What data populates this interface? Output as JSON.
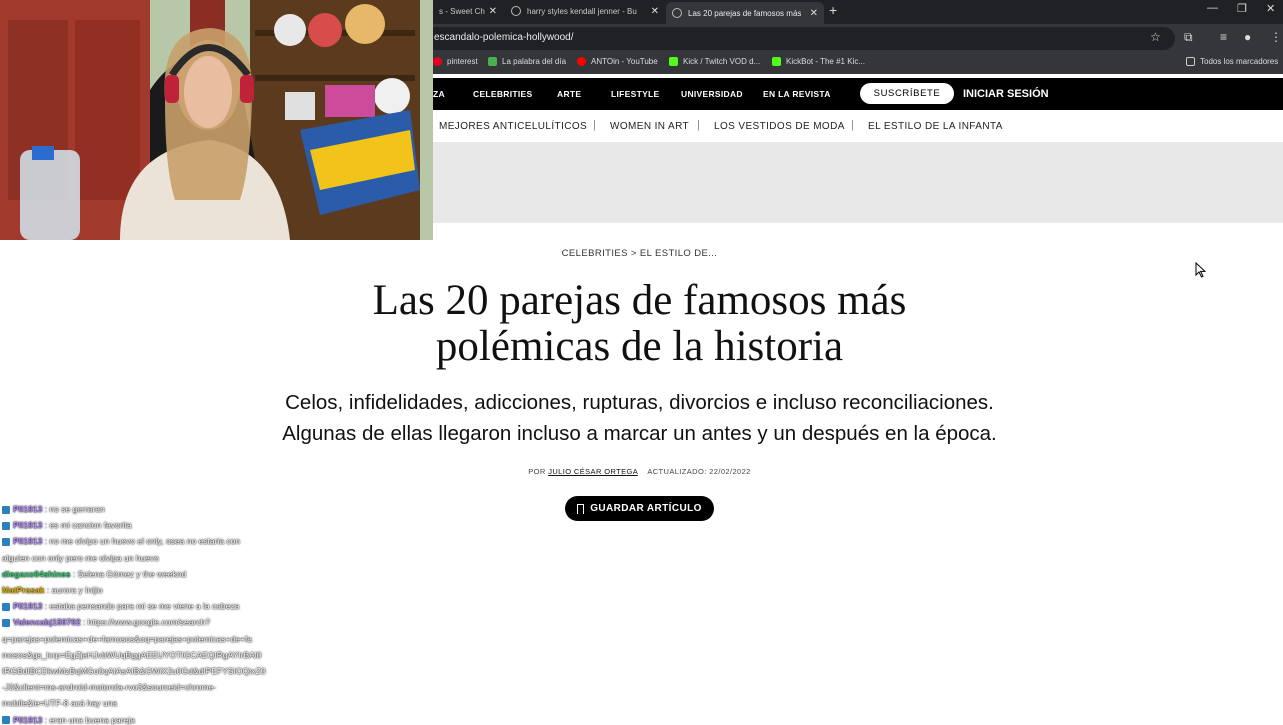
{
  "browser": {
    "tabs": [
      {
        "label": "s - Sweet Ch",
        "active": false
      },
      {
        "label": "harry styles kendall jenner - Bu",
        "active": false
      },
      {
        "label": "Las 20 parejas de famosos más",
        "active": true
      }
    ],
    "url": "escandalo-polemica-hollywood/",
    "bookmarks": [
      {
        "label": "pinterest",
        "color": "#e60023"
      },
      {
        "label": "La palabra del día",
        "color": "#4caf50"
      },
      {
        "label": "ANTOin - YouTube",
        "color": "#ff0000"
      },
      {
        "label": "Kick / Twitch VOD d...",
        "color": "#53fc18"
      },
      {
        "label": "KickBot - The #1 Kic...",
        "color": "#53fc18"
      }
    ],
    "all_bookmarks": "Todos los marcadores"
  },
  "site": {
    "nav": [
      "ZA",
      "CELEBRITIES",
      "ARTE",
      "LIFESTYLE",
      "UNIVERSIDAD",
      "EN LA REVISTA"
    ],
    "subscribe": "SUSCRÍBETE",
    "login": "INICIAR SESIÓN",
    "subnav": [
      "MEJORES ANTICELULÍTICOS",
      "WOMEN IN ART",
      "LOS VESTIDOS DE MODA",
      "EL ESTILO DE LA INFANTA"
    ]
  },
  "article": {
    "breadcrumb": "CELEBRITIES > EL ESTILO DE...",
    "headline_line1": "Las 20 parejas de famosos más",
    "headline_line2": "polémicas de la historia",
    "dek_line1": "Celos, infidelidades, adicciones, rupturas, divorcios e incluso reconciliaciones.",
    "dek_line2": "Algunas de ellas llegaron incluso a marcar un antes y un después en la época.",
    "byline_prefix": "POR",
    "author": "JULIO CÉSAR ORTEGA",
    "updated": "ACTUALIZADO: 22/02/2022",
    "save_button": "GUARDAR ARTÍCULO"
  },
  "chat": [
    {
      "user": "Pll1913",
      "color": "#b48cff",
      "badge": true,
      "text": ": no se gerraran"
    },
    {
      "user": "Pll1913",
      "color": "#b48cff",
      "badge": true,
      "text": ": es mi cancion favorita"
    },
    {
      "user": "Pll1913",
      "color": "#b48cff",
      "badge": true,
      "text": ": no me olvipo un huevo el only, osea no estaria con"
    },
    {
      "user": "",
      "color": "#ffffff",
      "badge": false,
      "text": "alguien con only pero me olvipa un huevo"
    },
    {
      "user": "diegaxo04shines",
      "color": "#2ecc71",
      "badge": false,
      "text": ": Selena Gómez y the weeknd"
    },
    {
      "user": "MatPrasak",
      "color": "#e6b800",
      "badge": false,
      "text": ": aurora y Inijio"
    },
    {
      "user": "Pll1913",
      "color": "#b48cff",
      "badge": true,
      "text": ": estaba pensando para mi se me viene a la cabeza"
    },
    {
      "user": "Valencabj150702",
      "color": "#b48cff",
      "badge": true,
      "text": ": https://www.google.com/search?"
    },
    {
      "user": "",
      "color": "#ffffff",
      "badge": false,
      "text": "q=parejas+polemicas+de+famosos&oq=parejas+polemicas+de+fa"
    },
    {
      "user": "",
      "color": "#ffffff",
      "badge": false,
      "text": "mosos&gs_lcrp=EgZjaHJvbWUqBggAEEUYOTIGCAEQIRgAYIrBAl0"
    },
    {
      "user": "",
      "color": "#ffffff",
      "badge": false,
      "text": "IRGBdIBCDkwMzBqMGo0qAIAsAIB&GWiX2u0Gd&dIPEFYSIOQtxZ0"
    },
    {
      "user": "",
      "color": "#ffffff",
      "badge": false,
      "text": "-J0&client=ms-android-motorola-rvo3&sourceid=chrome-"
    },
    {
      "user": "",
      "color": "#ffffff",
      "badge": false,
      "text": "mobile&ie=UTF-8 acá hay una"
    },
    {
      "user": "Pll1913",
      "color": "#b48cff",
      "badge": true,
      "text": ": eran una buena pareja"
    }
  ],
  "colors": {
    "browser_dark": "#202124",
    "browser_mid": "#35363a",
    "site_black": "#000000",
    "ad_gray": "#e8e8e8"
  }
}
